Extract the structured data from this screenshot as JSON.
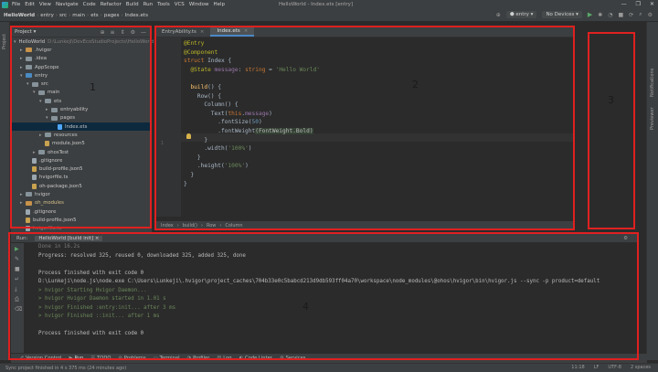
{
  "window": {
    "menu": [
      "File",
      "Edit",
      "View",
      "Navigate",
      "Code",
      "Refactor",
      "Build",
      "Run",
      "Tools",
      "VCS",
      "Window",
      "Help"
    ],
    "title": "HelloWorld - Index.ets [entry]",
    "controls": [
      "—",
      "❐",
      "✕"
    ]
  },
  "breadcrumb": [
    "HelloWorld",
    "entry",
    "src",
    "main",
    "ets",
    "pages",
    "Index.ets"
  ],
  "toolbar": {
    "module_select": "entry",
    "device_select": "No Devices"
  },
  "left_strip": {
    "label": "Project"
  },
  "project": {
    "title": "Project",
    "tree": [
      {
        "label": "HelloWorld",
        "hint": "D:\\Lunkeji\\DevEcoStudioProjects\\HelloWorld",
        "depth": 0,
        "arrow": "▾",
        "kind": "folder-blue"
      },
      {
        "label": ".hvigor",
        "depth": 1,
        "arrow": "▸",
        "kind": "folder-orange"
      },
      {
        "label": ".idea",
        "depth": 1,
        "arrow": "▸",
        "kind": "folder"
      },
      {
        "label": "AppScope",
        "depth": 1,
        "arrow": "▸",
        "kind": "folder"
      },
      {
        "label": "entry",
        "depth": 1,
        "arrow": "▾",
        "kind": "folder-blue"
      },
      {
        "label": "src",
        "depth": 2,
        "arrow": "▾",
        "kind": "folder"
      },
      {
        "label": "main",
        "depth": 3,
        "arrow": "▾",
        "kind": "folder"
      },
      {
        "label": "ets",
        "depth": 4,
        "arrow": "▾",
        "kind": "folder"
      },
      {
        "label": "entryability",
        "depth": 5,
        "arrow": "▸",
        "kind": "folder"
      },
      {
        "label": "pages",
        "depth": 5,
        "arrow": "▾",
        "kind": "folder"
      },
      {
        "label": "Index.ets",
        "depth": 6,
        "arrow": "",
        "kind": "file-ets",
        "selected": true
      },
      {
        "label": "resources",
        "depth": 4,
        "arrow": "▸",
        "kind": "folder"
      },
      {
        "label": "module.json5",
        "depth": 4,
        "arrow": "",
        "kind": "file-json"
      },
      {
        "label": "ohosTest",
        "depth": 3,
        "arrow": "▸",
        "kind": "folder"
      },
      {
        "label": ".gitignore",
        "depth": 2,
        "arrow": "",
        "kind": "file"
      },
      {
        "label": "build-profile.json5",
        "depth": 2,
        "arrow": "",
        "kind": "file-json"
      },
      {
        "label": "hvigorfile.ts",
        "depth": 2,
        "arrow": "",
        "kind": "file"
      },
      {
        "label": "oh-package.json5",
        "depth": 2,
        "arrow": "",
        "kind": "file-json"
      },
      {
        "label": "hvigor",
        "depth": 1,
        "arrow": "▸",
        "kind": "folder"
      },
      {
        "label": "oh_modules",
        "depth": 1,
        "arrow": "▸",
        "kind": "folder-orange",
        "module": true
      },
      {
        "label": ".gitignore",
        "depth": 1,
        "arrow": "",
        "kind": "file"
      },
      {
        "label": "build-profile.json5",
        "depth": 1,
        "arrow": "",
        "kind": "file-json"
      },
      {
        "label": "hvigorfile.ts",
        "depth": 1,
        "arrow": "",
        "kind": "file",
        "light": true
      }
    ]
  },
  "editor": {
    "tabs": [
      {
        "label": "EntryAbility.ts",
        "active": false
      },
      {
        "label": "Index.ets",
        "active": true
      }
    ],
    "code": [
      [
        [
          "c-deco",
          "@Entry"
        ]
      ],
      [
        [
          "c-deco",
          "@Component"
        ]
      ],
      [
        [
          "c-kw",
          "struct "
        ],
        [
          "c-plain",
          "Index {"
        ]
      ],
      [
        [
          "c-plain",
          "  "
        ],
        [
          "c-deco",
          "@State "
        ],
        [
          "c-prop",
          "message"
        ],
        [
          "c-plain",
          ": "
        ],
        [
          "c-kw",
          "string "
        ],
        [
          "c-plain",
          "= "
        ],
        [
          "c-str",
          "'Hello World'"
        ]
      ],
      [
        [
          "c-plain",
          ""
        ]
      ],
      [
        [
          "c-plain",
          "  "
        ],
        [
          "c-fn",
          "build"
        ],
        [
          "c-plain",
          "() {"
        ]
      ],
      [
        [
          "c-plain",
          "    Row() {"
        ]
      ],
      [
        [
          "c-plain",
          "      Column() {"
        ]
      ],
      [
        [
          "c-plain",
          "        Text("
        ],
        [
          "c-kw",
          "this"
        ],
        [
          "c-plain",
          "."
        ],
        [
          "c-prop",
          "message"
        ],
        [
          "c-plain",
          ")"
        ]
      ],
      [
        [
          "c-plain",
          "          .fontSize("
        ],
        [
          "c-num",
          "50"
        ],
        [
          "c-plain",
          ")"
        ]
      ],
      [
        [
          "c-plain",
          "          .fontWeight"
        ],
        [
          "c-hl",
          "(FontWeight.Bold)"
        ]
      ],
      [
        [
          "c-plain",
          "      }"
        ]
      ],
      [
        [
          "c-plain",
          "      .width("
        ],
        [
          "c-str",
          "'100%'"
        ],
        [
          "c-plain",
          ")"
        ]
      ],
      [
        [
          "c-plain",
          "    }"
        ]
      ],
      [
        [
          "c-plain",
          "    .height("
        ],
        [
          "c-str",
          "'100%'"
        ],
        [
          "c-plain",
          ")"
        ]
      ],
      [
        [
          "c-plain",
          "  }"
        ]
      ],
      [
        [
          "c-plain",
          "}"
        ]
      ]
    ],
    "gutter_marker": "1",
    "crumbs": [
      "Index",
      "build()",
      "Row",
      "Column"
    ]
  },
  "right_strip": [
    "Notifications",
    "Previewer"
  ],
  "run": {
    "label": "Run:",
    "tab": "HelloWorld [build init]",
    "lines": [
      {
        "text": "Done in 16.2s",
        "style": "faded"
      },
      {
        "text": "Progress: resolved 325, reused 0, downloaded 325, added 325, done",
        "style": ""
      },
      {
        "text": "",
        "style": ""
      },
      {
        "text": "Process finished with exit code 0",
        "style": ""
      },
      {
        "text": "D:\\Lunkeji\\node.js\\node.exe C:\\Users\\Lunkeji\\.hvigor\\project_caches\\704b33e0c5babcd213d9db593ff04a70\\workspace\\node_modules\\@ohos\\hvigor\\bin\\hvigor.js --sync -p product=default",
        "style": ""
      },
      {
        "text": "> hvigor Starting Hvigor Daemon...",
        "style": "ok"
      },
      {
        "text": "> hvigor Hvigor Daemon started in 1.01 s",
        "style": "ok"
      },
      {
        "text": "> hvigor Finished :entry:init... after 3 ms",
        "style": "ok"
      },
      {
        "text": "> hvigor Finished ::init... after 1 ms",
        "style": "ok"
      },
      {
        "text": "",
        "style": ""
      },
      {
        "text": "Process finished with exit code 0",
        "style": ""
      }
    ]
  },
  "bottom_tabs": [
    {
      "label": "Version Control",
      "icon": "⎇"
    },
    {
      "label": "Run",
      "icon": "▶",
      "active": true
    },
    {
      "label": "TODO",
      "icon": "☰"
    },
    {
      "label": "Problems",
      "icon": "⊘"
    },
    {
      "label": "Terminal",
      "icon": "▭"
    },
    {
      "label": "Profiler",
      "icon": "◔"
    },
    {
      "label": "Log",
      "icon": "▤"
    },
    {
      "label": "Code Linter",
      "icon": "◐"
    },
    {
      "label": "Services",
      "icon": "⚙"
    }
  ],
  "status": {
    "message": "Sync project finished in 4 s 375 ms (24 minutes ago)",
    "right": [
      "11:18",
      "LF",
      "UTF-8",
      "2 spaces"
    ]
  },
  "annotations": [
    "1",
    "2",
    "3",
    "4"
  ]
}
